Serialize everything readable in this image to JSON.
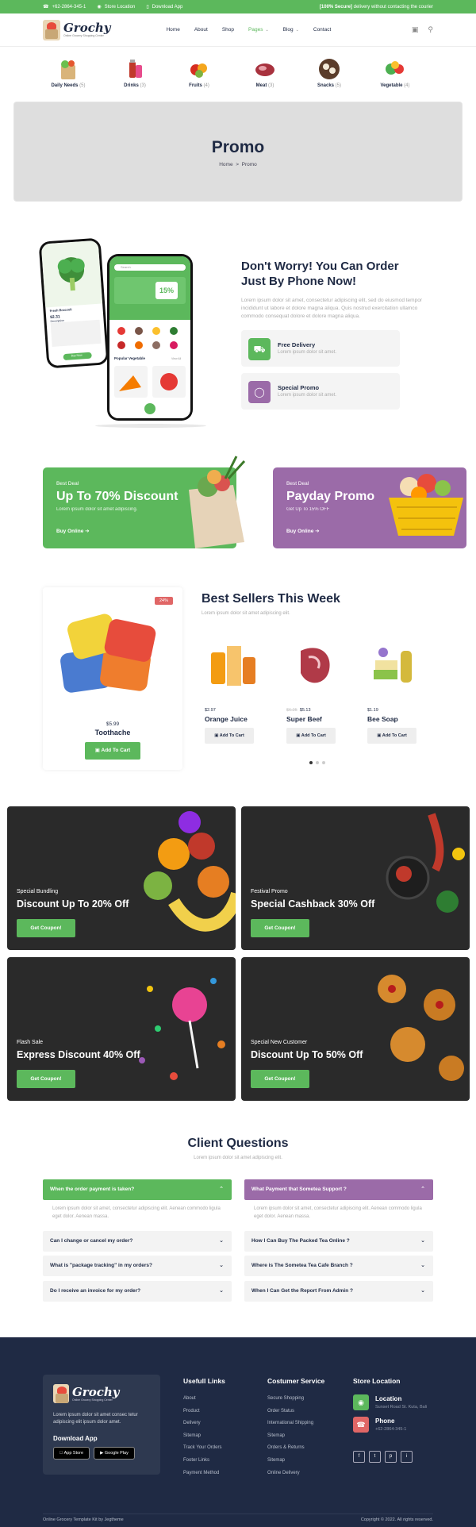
{
  "topbar": {
    "phone": "+62-2864-345-1",
    "location": "Store Location",
    "download": "Download App",
    "secure_bold": "[100% Secure]",
    "secure_text": "delivery without contacting the courier"
  },
  "brand": {
    "name": "Grochy",
    "tagline": "Online Grocery Shopping Center"
  },
  "nav": {
    "items": [
      "Home",
      "About",
      "Shop",
      "Pages",
      "Blog",
      "Contact"
    ]
  },
  "categories": [
    {
      "label": "Daily Needs",
      "count": "(5)"
    },
    {
      "label": "Drinks",
      "count": "(3)"
    },
    {
      "label": "Fruits",
      "count": "(4)"
    },
    {
      "label": "Meat",
      "count": "(3)"
    },
    {
      "label": "Snacks",
      "count": "(5)"
    },
    {
      "label": "Vegetable",
      "count": "(4)"
    }
  ],
  "banner": {
    "title": "Promo",
    "crumb_home": "Home",
    "crumb_sep": ">",
    "crumb_current": "Promo"
  },
  "phone_section": {
    "title_line1": "Don't Worry! You Can Order",
    "title_line2": "Just By Phone Now!",
    "desc": "Lorem ipsum dolor sit amet, consectetur adipiscing elit, sed do eiusmod tempor incididunt ut labore et dolore magna aliqua. Quis nostrud exercitation ullamco commodo consequat dolore et dolore magna aliqua.",
    "features": [
      {
        "title": "Free Delivery",
        "sub": "Lorem ipsum dolor sit amet."
      },
      {
        "title": "Special Promo",
        "sub": "Lorem ipsum dolor sit amet."
      }
    ],
    "app": {
      "search": "Search",
      "promo": "15%",
      "product": "Fresh Broccoli",
      "price": "$2.31",
      "desc_label": "Description",
      "buy": "Buy Now",
      "popular": "Popular Vegetable",
      "view_all": "View All"
    }
  },
  "deals": [
    {
      "label": "Best Deal",
      "title": "Up To 70% Discount",
      "sub": "Lorem ipsum dolor sit amet adipiscing.",
      "cta": "Buy Online"
    },
    {
      "label": "Best Deal",
      "title": "Payday Promo",
      "sub": "Get Up To 15% OFF",
      "cta": "Buy Online"
    }
  ],
  "bestsellers": {
    "title": "Best Sellers This Week",
    "sub": "Lorem ipsum dolor sit amet adipiscing elit.",
    "featured": {
      "badge": "24%",
      "price": "$5.99",
      "name": "Toothache",
      "cta": "Add To Cart"
    },
    "items": [
      {
        "price": "$2.97",
        "old": "",
        "name": "Orange Juice",
        "cta": "Add To Cart"
      },
      {
        "price": "$5.13",
        "old": "$6.25",
        "name": "Super Beef",
        "cta": "Add To Cart"
      },
      {
        "price": "$1.19",
        "old": "",
        "name": "Bee Soap",
        "cta": "Add To Cart"
      }
    ]
  },
  "coupons": [
    {
      "label": "Special Bundling",
      "title": "Discount Up To 20% Off",
      "cta": "Get Coupon!"
    },
    {
      "label": "Festival Promo",
      "title": "Special Cashback 30% Off",
      "cta": "Get Coupon!"
    },
    {
      "label": "Flash Sale",
      "title": "Express Discount 40% Off",
      "cta": "Get Coupon!"
    },
    {
      "label": "Special New Customer",
      "title": "Discount Up To 50% Off",
      "cta": "Get Coupon!"
    }
  ],
  "faq": {
    "title": "Client Questions",
    "sub": "Lorem ipsum dolor sit amet adipiscing elit.",
    "left_open": "When the order payment is taken?",
    "left_answer": "Lorem ipsum dolor sit amet, consectetur adipiscing elit. Aenean commodo ligula eget dolor. Aenean massa.",
    "left": [
      "Can I change or cancel my order?",
      "What is \"package tracking\" in my orders?",
      "Do I receive an invoice for my order?"
    ],
    "right_open": "What Payment that Sometea Support ?",
    "right_answer": "Lorem ipsum dolor sit amet, consectetur adipiscing elit. Aenean commodo ligula eget dolor. Aenean massa.",
    "right": [
      "How I Can Buy The Packed Tea Online ?",
      "Where is The Sometea Tea Cafe Branch ?",
      "When I Can Get the Report From Admin ?"
    ]
  },
  "footer": {
    "about": "Lorem ipsum dolor sit amet consec tetur adipiscing elit ipsum dolor amet.",
    "download_label": "Download App",
    "app_store": "App Store",
    "google_play": "Google Play",
    "col1_title": "Usefull Links",
    "col1": [
      "About",
      "Product",
      "Delivery",
      "Sitemap",
      "Track Your Orders",
      "Footer Links",
      "Payment Method"
    ],
    "col2_title": "Costumer Service",
    "col2": [
      "Secure Shopping",
      "Order Status",
      "International Shipping",
      "Sitemap",
      "Orders & Returns",
      "Sitemap",
      "Online Delivery"
    ],
    "col3_title": "Store Location",
    "location_title": "Location",
    "location_text": "Sunset Road St. Kuta, Bali",
    "phone_title": "Phone",
    "phone_text": "+62-2864-345-1",
    "social": [
      "f",
      "t",
      "p",
      "i"
    ],
    "bottom_left": "Online Grocery Template Kit by Jegtheme",
    "bottom_right": "Copyright © 2022. All rights reserved."
  }
}
